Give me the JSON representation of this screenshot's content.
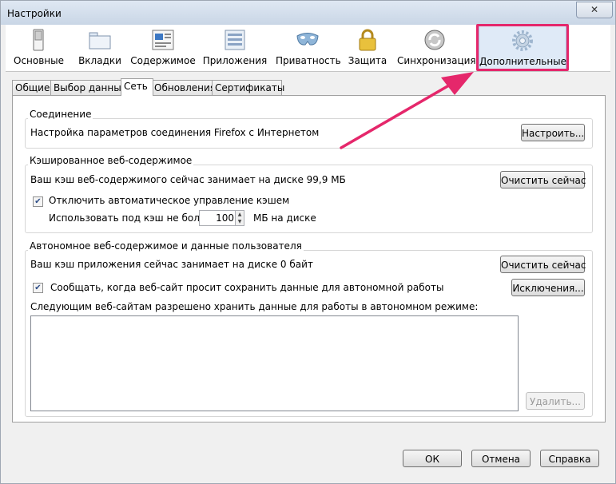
{
  "window": {
    "title": "Настройки",
    "close_label": "✕"
  },
  "toolbar": {
    "items": [
      {
        "label": "Основные",
        "icon": "switch-icon"
      },
      {
        "label": "Вкладки",
        "icon": "tabs-icon"
      },
      {
        "label": "Содержимое",
        "icon": "content-icon"
      },
      {
        "label": "Приложения",
        "icon": "applications-icon"
      },
      {
        "label": "Приватность",
        "icon": "mask-icon"
      },
      {
        "label": "Защита",
        "icon": "lock-icon"
      },
      {
        "label": "Синхронизация",
        "icon": "sync-icon"
      },
      {
        "label": "Дополнительные",
        "icon": "gear-icon"
      }
    ],
    "selected_index": 7
  },
  "tabs": [
    "Общие",
    "Выбор данных",
    "Сеть",
    "Обновления",
    "Сертификаты"
  ],
  "active_tab": 2,
  "connection": {
    "title": "Соединение",
    "description": "Настройка параметров соединения Firefox с Интернетом",
    "button": "Настроить..."
  },
  "cache": {
    "title": "Кэшированное веб-содержимое",
    "usage": "Ваш кэш веб-содержимого сейчас занимает на диске 99,9 МБ",
    "clear_button": "Очистить сейчас",
    "override_label": "Отключить автоматическое управление кэшем",
    "override_checked": true,
    "limit_label": "Использовать под кэш не более",
    "limit_value": "100",
    "limit_unit": "МБ на диске"
  },
  "offline": {
    "title": "Автономное веб-содержимое и данные пользователя",
    "usage": "Ваш кэш приложения сейчас занимает на диске 0 байт",
    "clear_button": "Очистить сейчас",
    "notify_label": "Сообщать, когда веб-сайт просит сохранить данные для автономной работы",
    "notify_checked": true,
    "exceptions_button": "Исключения...",
    "allowed_label": "Следующим веб-сайтам разрешено хранить данные для работы в автономном режиме:",
    "remove_button": "Удалить..."
  },
  "footer": {
    "ok": "ОК",
    "cancel": "Отмена",
    "help": "Справка"
  },
  "colors": {
    "highlight": "#e5276b",
    "arrow": "#e5276b"
  },
  "check_mark": "✔",
  "spin_up": "▲",
  "spin_down": "▼"
}
